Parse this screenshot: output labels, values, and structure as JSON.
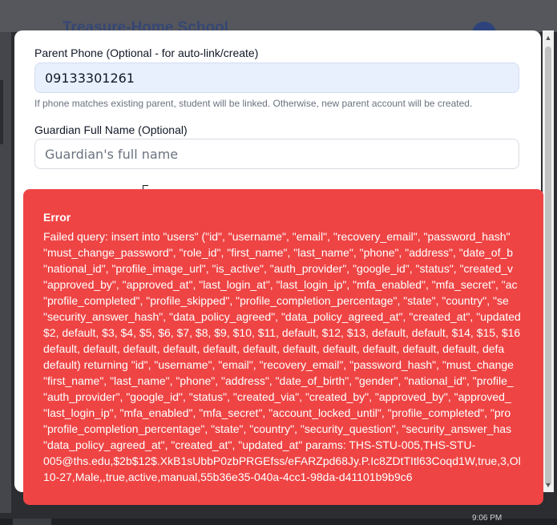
{
  "backdrop": {
    "title": "Treasure-Home School"
  },
  "form": {
    "parent_phone": {
      "label": "Parent Phone (Optional - for auto-link/create)",
      "value": "09133301261",
      "helper": "If phone matches existing parent, student will be linked. Otherwise, new parent account will be created."
    },
    "guardian_name": {
      "label": "Guardian Full Name (Optional)",
      "placeholder": "Guardian's full name",
      "value": ""
    }
  },
  "error": {
    "title": "Error",
    "lines": [
      "Failed query: insert into \"users\" (\"id\", \"username\", \"email\", \"recovery_email\", \"password_hash\"",
      "\"must_change_password\", \"role_id\", \"first_name\", \"last_name\", \"phone\", \"address\", \"date_of_b",
      "\"national_id\", \"profile_image_url\", \"is_active\", \"auth_provider\", \"google_id\", \"status\", \"created_v",
      "\"approved_by\", \"approved_at\", \"last_login_at\", \"last_login_ip\", \"mfa_enabled\", \"mfa_secret\", \"ac",
      "\"profile_completed\", \"profile_skipped\", \"profile_completion_percentage\", \"state\", \"country\", \"se",
      "\"security_answer_hash\", \"data_policy_agreed\", \"data_policy_agreed_at\", \"created_at\", \"updated",
      "$2, default, $3, $4, $5, $6, $7, $8, $9, $10, $11, default, $12, $13, default, default, $14, $15, $16",
      "default, default, default, default, default, default, default, default, default, default, default, defa",
      "default) returning \"id\", \"username\", \"email\", \"recovery_email\", \"password_hash\", \"must_change",
      "\"first_name\", \"last_name\", \"phone\", \"address\", \"date_of_birth\", \"gender\", \"national_id\", \"profile_",
      "\"auth_provider\", \"google_id\", \"status\", \"created_via\", \"created_by\", \"approved_by\", \"approved_",
      "\"last_login_ip\", \"mfa_enabled\", \"mfa_secret\", \"account_locked_until\", \"profile_completed\", \"pro",
      "\"profile_completion_percentage\", \"state\", \"country\", \"security_question\", \"security_answer_has",
      "\"data_policy_agreed_at\", \"created_at\", \"updated_at\" params: THS-STU-005,THS-STU-",
      "005@ths.edu,$2b$12$.XkB1sUbbP0zbPRGEfss/eFARZpd68Jy.P.Ic8ZDtTItl63Coqd1W,true,3,Ol",
      "10-27,Male,,true,active,manual,55b36e35-040a-4cc1-98da-d41101b9b9c6"
    ]
  },
  "taskbar": {
    "clock": "9:06 PM"
  },
  "icons": {
    "scroll_up": "scroll-up-arrow-icon",
    "scroll_down": "scroll-down-arrow-icon"
  },
  "colors": {
    "error_bg": "#ef4444",
    "input_filled_bg": "#e8f0fe",
    "brand": "#1e3a8a"
  }
}
